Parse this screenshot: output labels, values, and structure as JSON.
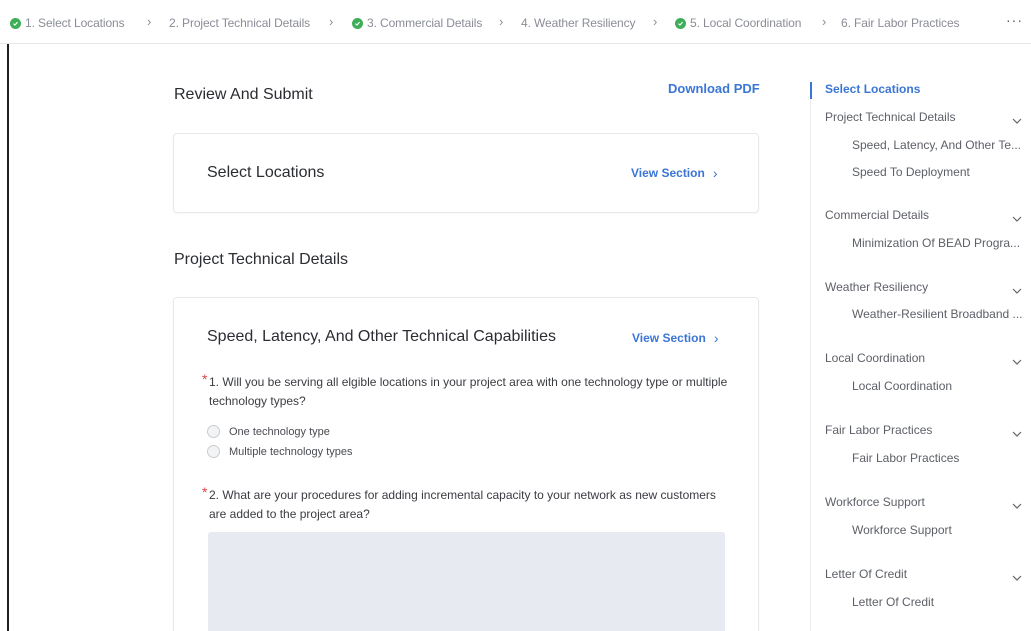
{
  "stepper": {
    "steps": [
      {
        "label": "1. Select Locations",
        "done": true
      },
      {
        "label": "2. Project Technical Details",
        "done": false
      },
      {
        "label": "3. Commercial Details",
        "done": true
      },
      {
        "label": "4. Weather Resiliency",
        "done": false
      },
      {
        "label": "5. Local Coordination",
        "done": true
      },
      {
        "label": "6. Fair Labor Practices",
        "done": false
      }
    ],
    "more": "···"
  },
  "header": {
    "title": "Review And Submit",
    "download": "Download PDF"
  },
  "sections": {
    "select_locations": {
      "title": "Select Locations",
      "view": "View Section"
    },
    "project_technical": {
      "heading": "Project Technical Details",
      "card_title": "Speed, Latency, And Other Technical Capabilities",
      "view": "View Section",
      "q1": {
        "required": "*",
        "text": "1. Will you be serving all elgible locations in your project area with one technology type or multiple technology types?",
        "options": [
          "One technology type",
          "Multiple technology types"
        ]
      },
      "q2": {
        "required": "*",
        "text": "2. What are your procedures for adding incremental capacity to your network as new customers are added to the project area?"
      }
    }
  },
  "nav": {
    "items": [
      {
        "label": "Select Locations",
        "active": true,
        "subs": []
      },
      {
        "label": "Project Technical Details",
        "active": false,
        "subs": [
          "Speed, Latency, And Other Te...",
          "Speed To Deployment"
        ]
      },
      {
        "label": "Commercial Details",
        "active": false,
        "subs": [
          "Minimization Of BEAD Progra..."
        ]
      },
      {
        "label": "Weather Resiliency",
        "active": false,
        "subs": [
          "Weather-Resilient Broadband ..."
        ]
      },
      {
        "label": "Local Coordination",
        "active": false,
        "subs": [
          "Local Coordination"
        ]
      },
      {
        "label": "Fair Labor Practices",
        "active": false,
        "subs": [
          "Fair Labor Practices"
        ]
      },
      {
        "label": "Workforce Support",
        "active": false,
        "subs": [
          "Workforce Support"
        ]
      },
      {
        "label": "Letter Of Credit",
        "active": false,
        "subs": [
          "Letter Of Credit"
        ]
      }
    ]
  },
  "colors": {
    "accent": "#3b76d6",
    "check": "#3fae5a",
    "required": "#e0414b"
  }
}
